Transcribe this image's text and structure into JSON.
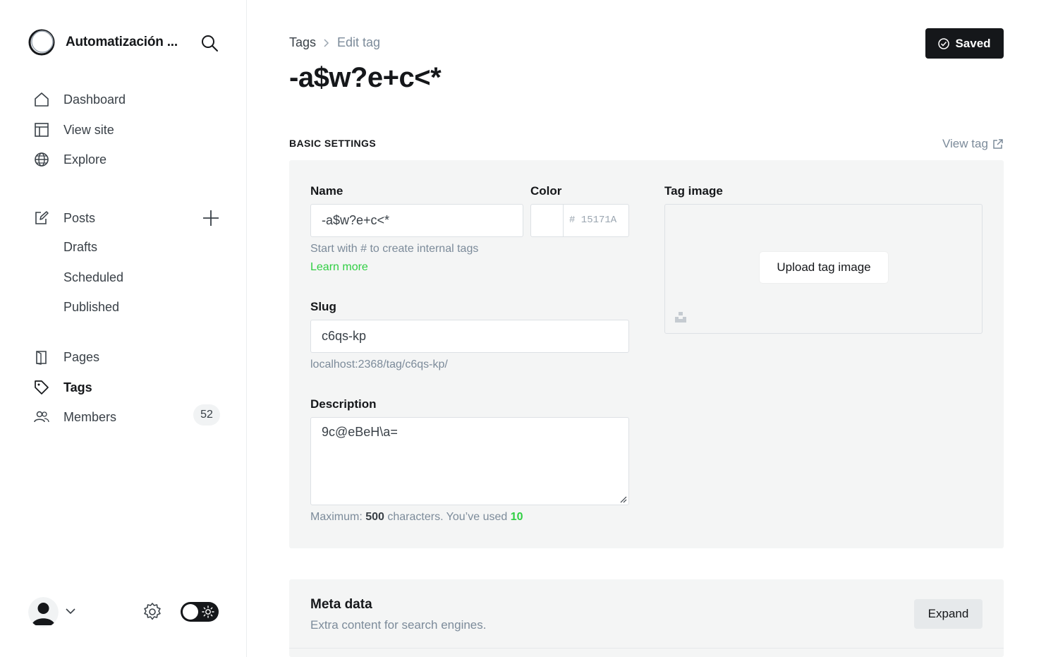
{
  "site": {
    "title": "Automatización ..."
  },
  "nav": {
    "dashboard": "Dashboard",
    "view_site": "View site",
    "explore": "Explore",
    "posts": "Posts",
    "drafts": "Drafts",
    "scheduled": "Scheduled",
    "published": "Published",
    "pages": "Pages",
    "tags": "Tags",
    "members": "Members",
    "members_count": "52"
  },
  "breadcrumb": {
    "parent": "Tags",
    "current": "Edit tag"
  },
  "page": {
    "title": "-a$w?e+c<*",
    "saved_label": "Saved"
  },
  "basic": {
    "section": "BASIC SETTINGS",
    "view_tag": "View tag"
  },
  "form": {
    "name_label": "Name",
    "name_value": "-a$w?e+c<*",
    "name_hint": "Start with # to create internal tags",
    "learn_more": "Learn more",
    "color_label": "Color",
    "color_value": "# 15171A",
    "tag_image_label": "Tag image",
    "upload_label": "Upload tag image",
    "slug_label": "Slug",
    "slug_value": "c6qs-kp",
    "slug_url": "localhost:2368/tag/c6qs-kp/",
    "description_label": "Description",
    "description_value": "9c@eBeH\\a=",
    "max_prefix": "Maximum: ",
    "max_value": "500",
    "max_mid": " characters. You’ve used ",
    "used_value": "10"
  },
  "meta": {
    "title": "Meta data",
    "subtitle": "Extra content for search engines.",
    "expand": "Expand"
  },
  "colors": {
    "accent": "#30cf43",
    "primary": "#15171a",
    "muted": "#7c8b9a",
    "panel": "#f4f5f5"
  }
}
